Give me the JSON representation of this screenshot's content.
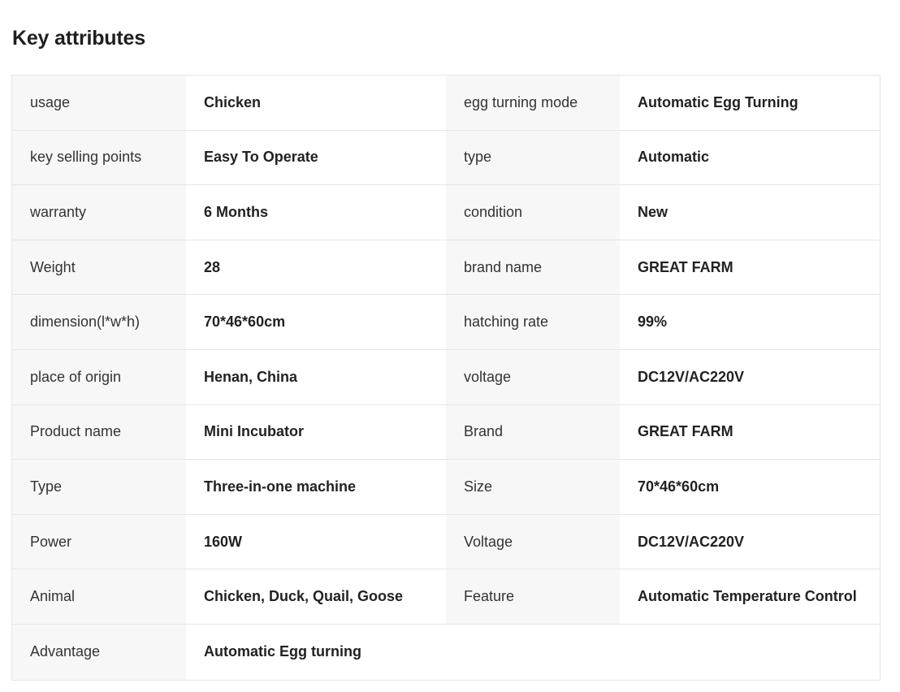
{
  "section": {
    "title": "Key attributes"
  },
  "rows": [
    {
      "k1": "usage",
      "v1": "Chicken",
      "k2": "egg turning mode",
      "v2": "Automatic Egg Turning"
    },
    {
      "k1": "key selling points",
      "v1": "Easy To Operate",
      "k2": "type",
      "v2": "Automatic"
    },
    {
      "k1": "warranty",
      "v1": "6 Months",
      "k2": "condition",
      "v2": "New"
    },
    {
      "k1": "Weight",
      "v1": "28",
      "k2": "brand name",
      "v2": "GREAT FARM"
    },
    {
      "k1": "dimension(l*w*h)",
      "v1": "70*46*60cm",
      "k2": "hatching rate",
      "v2": "99%"
    },
    {
      "k1": "place of origin",
      "v1": "Henan, China",
      "k2": "voltage",
      "v2": "DC12V/AC220V"
    },
    {
      "k1": "Product name",
      "v1": "Mini Incubator",
      "k2": "Brand",
      "v2": "GREAT FARM"
    },
    {
      "k1": "Type",
      "v1": "Three-in-one machine",
      "k2": "Size",
      "v2": "70*46*60cm"
    },
    {
      "k1": "Power",
      "v1": "160W",
      "k2": "Voltage",
      "v2": "DC12V/AC220V"
    },
    {
      "k1": "Animal",
      "v1": "Chicken, Duck, Quail, Goose",
      "k2": "Feature",
      "v2": "Automatic Temperature Control"
    },
    {
      "k1": "Advantage",
      "v1": "Automatic Egg turning",
      "k2": "",
      "v2": ""
    }
  ]
}
